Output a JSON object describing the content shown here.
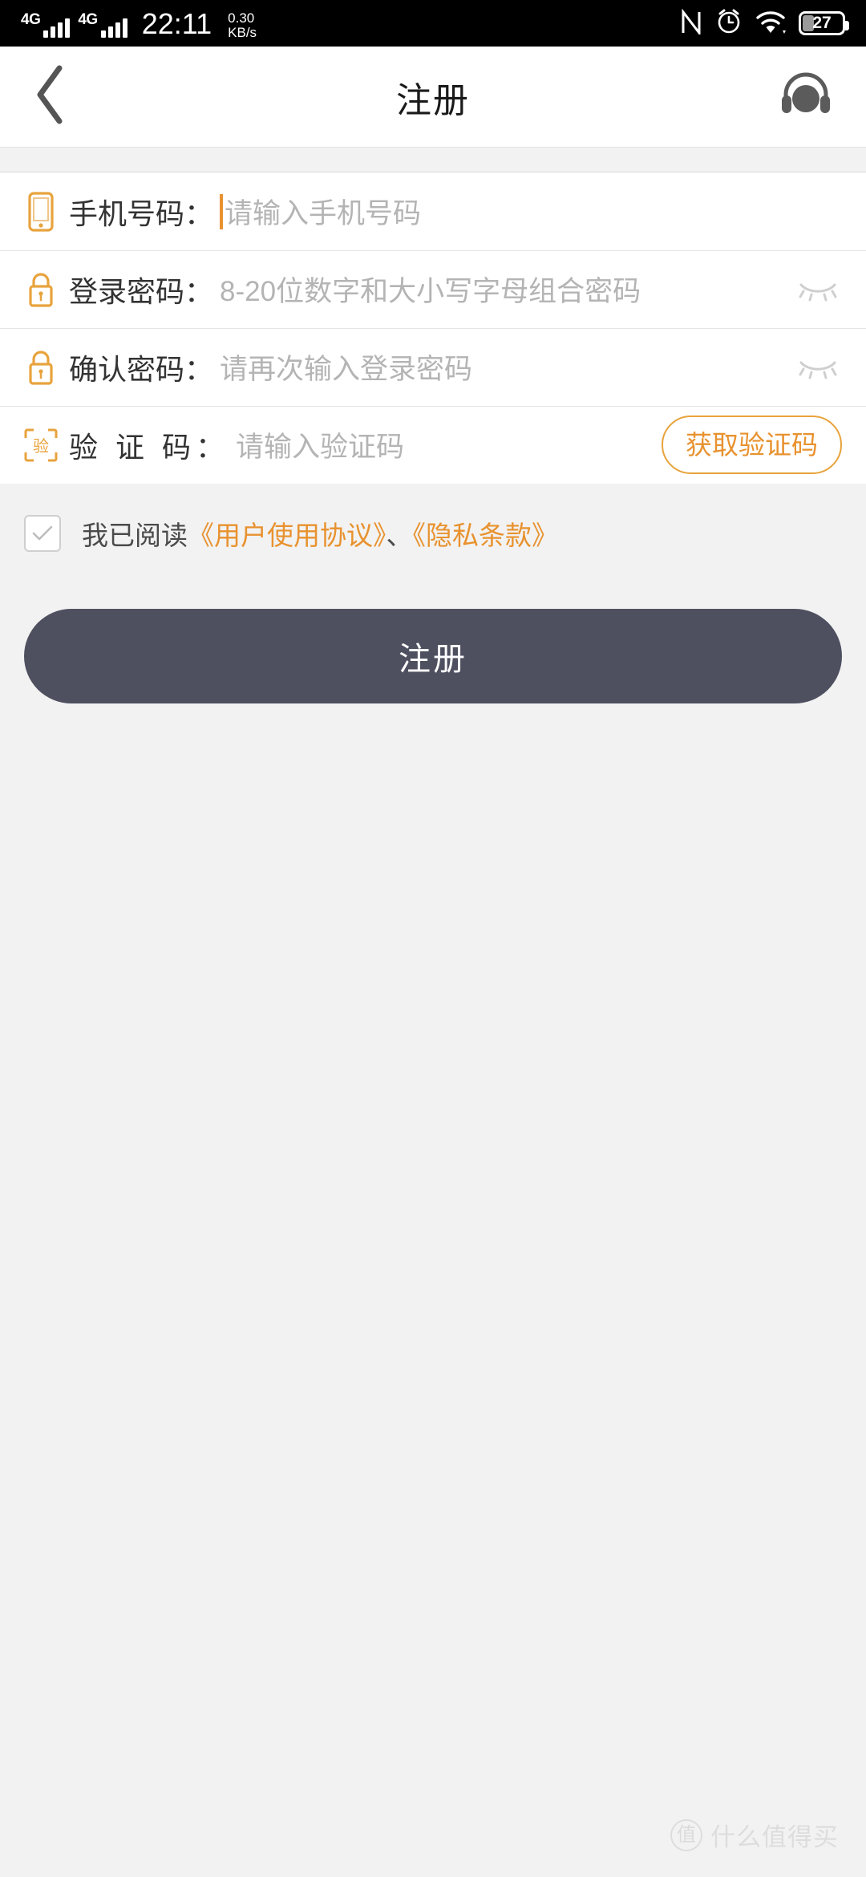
{
  "status_bar": {
    "sim1_network": "4G",
    "sim2_network": "4G",
    "time": "22:11",
    "net_speed_value": "0.30",
    "net_speed_unit": "KB/s",
    "nfc_icon": "nfc-icon",
    "alarm_icon": "alarm-clock-icon",
    "wifi_icon": "wifi-icon",
    "battery_percent": "27"
  },
  "nav": {
    "back_icon": "chevron-left-icon",
    "title": "注册",
    "service_icon": "headset-customer-service-icon"
  },
  "form": {
    "phone": {
      "icon": "mobile-phone-icon",
      "label": "手机号码：",
      "value": "",
      "placeholder": "请输入手机号码",
      "focused": true
    },
    "password": {
      "icon": "lock-icon",
      "label": "登录密码：",
      "value": "",
      "placeholder": "8-20位数字和大小写字母组合密码",
      "toggle_icon": "eye-closed-icon"
    },
    "confirm_password": {
      "icon": "lock-icon",
      "label": "确认密码：",
      "value": "",
      "placeholder": "请再次输入登录密码",
      "toggle_icon": "eye-closed-icon"
    },
    "verify_code": {
      "icon": "scan-verify-code-icon",
      "label": "验 证 码：",
      "value": "",
      "placeholder": "请输入验证码",
      "get_code_label": "获取验证码"
    }
  },
  "agreement": {
    "checked": false,
    "prefix": "我已阅读",
    "link_user_agreement": "《用户使用协议》",
    "separator": "、",
    "link_privacy": "《隐私条款》"
  },
  "submit": {
    "label": "注册"
  },
  "watermark": {
    "logo_char": "值",
    "text": "什么值得买"
  },
  "colors": {
    "accent_orange": "#e8922f",
    "submit_bg": "#4e5060",
    "page_bg": "#f2f2f2",
    "placeholder": "#b4b4b4"
  }
}
